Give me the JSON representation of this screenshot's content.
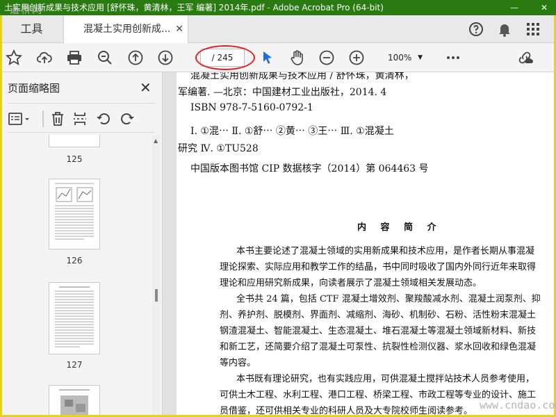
{
  "window": {
    "title": "土实用创新成果与技术应用 [舒怀珠，黄清林，王军 编著] 2014年.pdf - Adobe Acrobat Pro (64-bit)",
    "minimize_glyph": "—",
    "close_glyph": "✕",
    "watermark_top": "道桥网",
    "watermark_bottom": "www.cndao.com"
  },
  "tabs": {
    "tools_label": "工具",
    "document_label": "混凝土实用创新成...",
    "close_glyph": "✕",
    "right_icons": [
      "help-icon",
      "notification-bell-icon",
      "apps-grid-icon"
    ]
  },
  "toolbar": {
    "page_display": "/ 245",
    "zoom_label": "100%",
    "zoom_caret": "▼",
    "icons": [
      "bookmark-star-icon",
      "upload-cloud-icon",
      "print-icon",
      "search-zoom-icon",
      "page-up-icon",
      "page-down-icon",
      "select-cursor-icon",
      "hand-pan-icon",
      "zoom-out-icon",
      "zoom-in-icon",
      "more-options-icon",
      "share-link-icon"
    ]
  },
  "sidebar": {
    "title": "页面缩略图",
    "close_glyph": "✕",
    "tools": [
      "thumbnail-options-icon",
      "delete-page-icon",
      "extract-page-icon",
      "rotate-ccw-icon",
      "rotate-cw-icon"
    ],
    "thumbnails": [
      {
        "label": "125"
      },
      {
        "label": "126"
      },
      {
        "label": "127"
      }
    ],
    "scroll_up_glyph": "▲",
    "collapse_glyph": "◀"
  },
  "document": {
    "lines": [
      "混凝土实用创新成果与技术应用 / 舒怀珠，黄清林，",
      "军编著. —北京：中国建材工业出版社，2014. 4",
      "ISBN 978-7-5160-0792-1",
      "Ⅰ. ①混⋯ Ⅱ. ①舒⋯ ②黄⋯ ③王⋯ Ⅲ. ①混凝土",
      "研究 Ⅳ. ①TU528",
      "中国版本图书馆 CIP 数据核字（2014）第 064463 号"
    ],
    "heading": "内 容 简 介",
    "body": [
      "本书主要论述了混凝土领域的实用新成果和技术应用，是作者长期从事混凝",
      "理论探索、实际应用和教学工作的结晶，书中同时吸收了国内外同行近年来取得",
      "理论和应用研究新成果，向读者展示了混凝土领域相关发展动态。",
      "全书共 24 篇，包括 CTF 混凝土增效剂、聚羧酸减水剂、混凝土润泵剂、抑",
      "剂、养护剂、脱模剂、界面剂、减缩剂、海砂、机制砂、石粉、活性粉末混凝土",
      "钢渣混凝土、智能混凝土、生态混凝土、堆石混凝土等混凝土领域新材料、新技",
      "和新工艺，还简要介绍了混凝土可泵性、抗裂性检测仪器、浆水回收和绿色混凝",
      "等内容。",
      "本书既有理论研究，也有实践应用，可供混凝土搅拌站技术人员参考使用，",
      "可供土木工程、水利工程、港口工程、桥梁工程、市政工程等专业的设计、施工",
      "员借鉴，还可供相关专业的科研人员及大专院校师生阅读参考。"
    ]
  }
}
